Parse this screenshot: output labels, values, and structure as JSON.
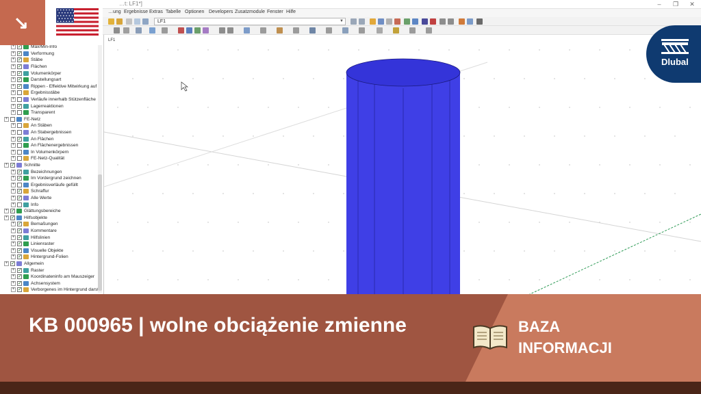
{
  "app": {
    "title": "…t: LF1*]",
    "menu": [
      "…ung",
      "Ergebnisse",
      "Extras",
      "Tabelle",
      "Optionen",
      "Developers",
      "Zusatzmodule",
      "Fenster",
      "Hilfe"
    ],
    "load_case": "LF1",
    "viewport_label": "LF1"
  },
  "window_buttons": [
    "–",
    "❐",
    "✕"
  ],
  "navigator": {
    "items": [
      {
        "label": "Max/Min-Info",
        "indent": 2,
        "checked": true
      },
      {
        "label": "Verformung",
        "indent": 2,
        "checked": true
      },
      {
        "label": "Stäbe",
        "indent": 2,
        "checked": true
      },
      {
        "label": "Flächen",
        "indent": 2,
        "checked": true
      },
      {
        "label": "Volumenkörper",
        "indent": 2,
        "checked": true
      },
      {
        "label": "Darstellungsart",
        "indent": 2,
        "checked": true
      },
      {
        "label": "Rippen - Effektive Mitwirkung auf F",
        "indent": 2,
        "checked": true
      },
      {
        "label": "Ergebnisstäbe",
        "indent": 2,
        "checked": false
      },
      {
        "label": "Verläufe innerhalb Stützenfläche",
        "indent": 2,
        "checked": false
      },
      {
        "label": "Lagerreaktionen",
        "indent": 2,
        "checked": true
      },
      {
        "label": "Transparent",
        "indent": 2,
        "checked": false
      },
      {
        "label": "FE-Netz",
        "indent": 1,
        "checked": false
      },
      {
        "label": "An Stäben",
        "indent": 2,
        "checked": false
      },
      {
        "label": "An Stabergebnissen",
        "indent": 2,
        "checked": false
      },
      {
        "label": "An Flächen",
        "indent": 2,
        "checked": true
      },
      {
        "label": "An Flächenergebnissen",
        "indent": 2,
        "checked": false
      },
      {
        "label": "In Volumenkörpern",
        "indent": 2,
        "checked": false
      },
      {
        "label": "FE-Netz-Qualität",
        "indent": 2,
        "checked": false
      },
      {
        "label": "Schnitte",
        "indent": 1,
        "checked": true
      },
      {
        "label": "Bezeichnungen",
        "indent": 2,
        "checked": true
      },
      {
        "label": "Im Vordergrund zeichnen",
        "indent": 2,
        "checked": true
      },
      {
        "label": "Ergebnisverläufe gefüllt",
        "indent": 2,
        "checked": false
      },
      {
        "label": "Schraffur",
        "indent": 2,
        "checked": true
      },
      {
        "label": "Alle Werte",
        "indent": 2,
        "checked": true
      },
      {
        "label": "Info",
        "indent": 2,
        "checked": false
      },
      {
        "label": "Glättungsbereiche",
        "indent": 1,
        "checked": true
      },
      {
        "label": "Hilfsobjekte",
        "indent": 1,
        "checked": true
      },
      {
        "label": "Bemaßungen",
        "indent": 2,
        "checked": true
      },
      {
        "label": "Kommentare",
        "indent": 2,
        "checked": true
      },
      {
        "label": "Hilfslinien",
        "indent": 2,
        "checked": true
      },
      {
        "label": "Linienraster",
        "indent": 2,
        "checked": true
      },
      {
        "label": "Visuelle Objekte",
        "indent": 2,
        "checked": true
      },
      {
        "label": "Hintergrund-Folien",
        "indent": 2,
        "checked": true
      },
      {
        "label": "Allgemein",
        "indent": 1,
        "checked": true
      },
      {
        "label": "Raster",
        "indent": 2,
        "checked": true
      },
      {
        "label": "Koordinateninfo am Mauszeiger",
        "indent": 2,
        "checked": true
      },
      {
        "label": "Achsensystem",
        "indent": 2,
        "checked": true
      },
      {
        "label": "Verborgenes im Hintergrund darste",
        "indent": 2,
        "checked": true
      }
    ]
  },
  "overlay": {
    "title": "KB 000965 | wolne obciążenie zmienne",
    "kb_label_line1": "BAZA",
    "kb_label_line2": "INFORMACJI",
    "logo_text": "Dlubal",
    "corner_arrow": "↘"
  },
  "colors": {
    "banner_dark": "#9f5541",
    "banner_light": "#c97a5e",
    "corner_tab": "#c5694f",
    "bottom_strip": "#4a2518",
    "logo_blue": "#0f3a70",
    "column_fill": "#3f3fe6",
    "column_top": "#3434d9"
  },
  "icons": [
    "corner-arrow-icon",
    "us-flag-icon",
    "dlubal-logo-icon",
    "book-icon",
    "cursor-icon"
  ]
}
